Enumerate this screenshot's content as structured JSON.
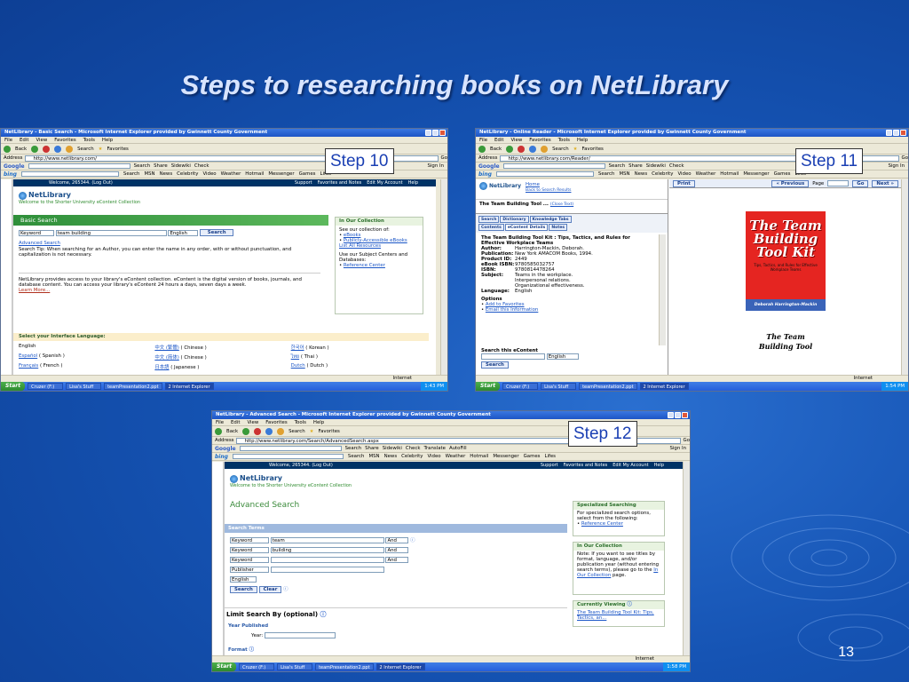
{
  "slide": {
    "title": "Steps to researching books on NetLibrary",
    "page_number": "13"
  },
  "common": {
    "menu": [
      "File",
      "Edit",
      "View",
      "Favorites",
      "Tools",
      "Help"
    ],
    "toolbar": {
      "back": "Back",
      "search": "Search",
      "favorites": "Favorites"
    },
    "address_label": "Address",
    "go": "Go",
    "google": "Google",
    "google_bar": {
      "search": "Search",
      "share": "Share",
      "sidewiki": "Sidewiki",
      "check": "Check",
      "sign_in": "Sign In"
    },
    "bing_bar": {
      "search": "Search",
      "msn": "MSN",
      "news": "News",
      "celebrity": "Celebrity",
      "video": "Video",
      "weather": "Weather",
      "hotmail": "Hotmail",
      "messenger": "Messenger",
      "games": "Games",
      "lifes": "Lifes"
    },
    "start": "Start",
    "taskbar": {
      "cruzer": "Cruzer (F:)",
      "lisa": "Lisa's Stuff",
      "ppt": "teamPresentation2.ppt",
      "ie": "2 Internet Explorer"
    },
    "internet": "Internet"
  },
  "step10": {
    "label": "Step 10",
    "window_title": "NetLibrary - Basic Search - Microsoft Internet Explorer provided by Gwinnett County Government",
    "address": "http://www.netlibrary.com/",
    "welcome_bar": "Welcome, 265344. (Log Out)",
    "nav_links": [
      "Support",
      "Favorites and Notes",
      "Edit My Account",
      "Help"
    ],
    "logo": "NetLibrary",
    "welcome_text": "Welcome to the Shorter University eContent Collection",
    "basic_search": "Basic Search",
    "keyword_select": "Keyword",
    "search_value": "team building",
    "lang_select": "English",
    "search_button": "Search",
    "advanced_link": "Advanced Search",
    "tip": "Search Tip: When searching for an Author, you can enter the name in any order, with or without punctuation, and capitalization is not necessary.",
    "collection_hd": "In Our Collection",
    "collection_text": "See our collection of:",
    "collection_links": [
      "eBooks",
      "Publicly-Accessible eBooks",
      "List All Resources"
    ],
    "subject_text": "Use our Subject Centers and Databases:",
    "reference_link": "Reference Center",
    "intro": "NetLibrary provides access to your library's eContent collection. eContent is the digital version of books, journals, and database content. You can access your library's eContent 24 hours a days, seven days a week.",
    "learn_more": "Learn More...",
    "language_hd": "Select your Interface Language:",
    "languages": [
      {
        "name": "English",
        "note": ""
      },
      {
        "name": "Español",
        "note": "( Spanish )"
      },
      {
        "name": "Français",
        "note": "( French )"
      },
      {
        "name": "中文 (繁體)",
        "note": "( Chinese )"
      },
      {
        "name": "中文 (简体)",
        "note": "( Chinese )"
      },
      {
        "name": "日本語",
        "note": "( Japanese )"
      },
      {
        "name": "한국어",
        "note": "( Korean )"
      },
      {
        "name": "ไทย",
        "note": "( Thai )"
      },
      {
        "name": "Dutch",
        "note": "( Dutch )"
      }
    ],
    "clock": "1:43 PM"
  },
  "step11": {
    "label": "Step 11",
    "window_title": "NetLibrary - Online Reader - Microsoft Internet Explorer provided by Gwinnett County Government",
    "address": "http://www.netlibrary.com/Reader/",
    "home_link": "Home",
    "back_link": "Back to Search Results",
    "book_short": "The Team Building Tool ...",
    "close_text": "(Close Text)",
    "tabs": [
      "Search",
      "Dictionary",
      "Knowledge Tabs",
      "Contents",
      "eContent Details",
      "Notes"
    ],
    "book_title": "The Team Building Tool Kit : Tips, Tactics, and Rules for Effective Workplace Teams",
    "details": [
      {
        "k": "Author:",
        "v": "Harrington-Mackin, Deborah."
      },
      {
        "k": "Publication:",
        "v": "New York AMACOM Books, 1994."
      },
      {
        "k": "Product ID:",
        "v": "2449"
      },
      {
        "k": "eBook ISBN:",
        "v": "9780585032757"
      },
      {
        "k": "ISBN:",
        "v": "9780814478264"
      },
      {
        "k": "Subject:",
        "v": "Teams in the workplace. Interpersonal relations. Organizational effectiveness."
      },
      {
        "k": "Language:",
        "v": "English"
      }
    ],
    "options_hd": "Options",
    "options": [
      "Add to Favorites",
      "Email this Information"
    ],
    "search_econtent": "Search this eContent",
    "lang": "English",
    "search_btn": "Search",
    "print": "Print",
    "prev": "« Previous",
    "page_label": "Page",
    "go_btn": "Go",
    "next": "Next »",
    "cover_title": "The Team Building Tool Kit",
    "cover_sub": "Tips, Tactics, and Rules for Effective Workplace Teams",
    "cover_author": "Deborah Harrington-Mackin",
    "text_page": "The Team Building Tool",
    "clock": "1:54 PM"
  },
  "step12": {
    "label": "Step 12",
    "window_title": "NetLibrary - Advanced Search - Microsoft Internet Explorer provided by Gwinnett County Government",
    "address": "http://www.netlibrary.com/Search/AdvancedSearch.aspx",
    "translate": "Translate",
    "autofill": "AutoFill",
    "welcome_bar": "Welcome, 265344. (Log Out)",
    "nav_links": [
      "Support",
      "Favorites and Notes",
      "Edit My Account",
      "Help"
    ],
    "logo": "NetLibrary",
    "welcome_text": "Welcome to the Shorter University eContent Collection",
    "adv_title": "Advanced Search",
    "terms_hd": "Search Terms",
    "rows": [
      {
        "field": "Keyword",
        "value": "team",
        "op": "And"
      },
      {
        "field": "Keyword",
        "value": "building",
        "op": "And"
      },
      {
        "field": "Keyword",
        "value": "",
        "op": "And"
      }
    ],
    "publisher": "Publisher",
    "english": "English",
    "search_btn": "Search",
    "clear_btn": "Clear",
    "limit": "Limit Search By (optional)",
    "year_published": "Year Published",
    "year_label": "Year:",
    "format": "Format",
    "spec_hd": "Specialized Searching",
    "spec_text": "For specialized search options, select from the following:",
    "spec_link": "Reference Center",
    "coll_hd": "In Our Collection",
    "note": "Note: If you want to see titles by format, language, and/or publication year (without entering search terms), please go to the",
    "note_link": "In Our Collection",
    "note_end": "page.",
    "viewing_hd": "Currently Viewing",
    "viewing_link": "The Team Building Tool Kit: Tips, Tactics, an...",
    "clock": "1:58 PM"
  }
}
